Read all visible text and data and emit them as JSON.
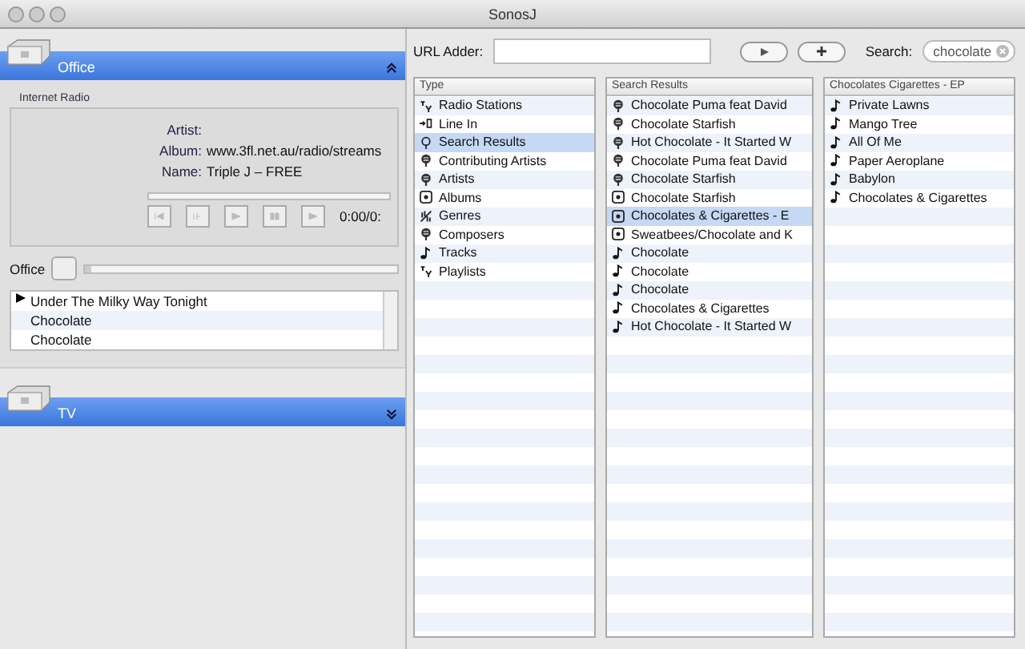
{
  "window": {
    "title": "SonosJ"
  },
  "zones": [
    {
      "name": "Office",
      "expanded": true
    },
    {
      "name": "TV",
      "expanded": false
    }
  ],
  "now_playing": {
    "source": "Internet Radio",
    "fields": [
      {
        "label": "Artist:"
      },
      {
        "label": "Album:",
        "value": "www.3fl.net.au/radio/streams"
      },
      {
        "label": "Name:",
        "value": "Triple J – FREE"
      }
    ],
    "time": "0:00/0:",
    "progress": {
      "level": 0
    }
  },
  "volume": {
    "zone": "Office",
    "level": 0.02
  },
  "queue": [
    {
      "title": "Under The Milky Way Tonight",
      "playing": true
    },
    {
      "title": "Chocolate",
      "playing": false
    },
    {
      "title": "Chocolate",
      "playing": false
    }
  ],
  "toolbar": {
    "url_label": "URL Adder:",
    "search_label": "Search:",
    "search_value": "chocolate"
  },
  "columns": [
    {
      "header": "Type",
      "items": [
        {
          "label": "Radio Stations",
          "kind": "radio",
          "selected": false
        },
        {
          "label": "Line In",
          "kind": "line-in",
          "selected": false
        },
        {
          "label": "Search Results",
          "kind": "search",
          "selected": true
        },
        {
          "label": "Contributing Artists",
          "kind": "artist",
          "selected": false
        },
        {
          "label": "Artists",
          "kind": "artist",
          "selected": false
        },
        {
          "label": "Albums",
          "kind": "album",
          "selected": false
        },
        {
          "label": "Genres",
          "kind": "genre",
          "selected": false
        },
        {
          "label": "Composers",
          "kind": "artist",
          "selected": false
        },
        {
          "label": "Tracks",
          "kind": "track",
          "selected": false
        },
        {
          "label": "Playlists",
          "kind": "radio",
          "selected": false
        }
      ]
    },
    {
      "header": "Search Results",
      "items": [
        {
          "label": "Chocolate Puma feat David",
          "kind": "artist",
          "selected": false
        },
        {
          "label": "Chocolate Starfish",
          "kind": "artist",
          "selected": false
        },
        {
          "label": "Hot Chocolate - It Started W",
          "kind": "artist",
          "selected": false
        },
        {
          "label": "Chocolate Puma feat David",
          "kind": "artist",
          "selected": false
        },
        {
          "label": "Chocolate Starfish",
          "kind": "artist",
          "selected": false
        },
        {
          "label": "Chocolate Starfish",
          "kind": "album",
          "selected": false
        },
        {
          "label": "Chocolates & Cigarettes - E",
          "kind": "album",
          "selected": true
        },
        {
          "label": "Sweatbees/Chocolate and K",
          "kind": "album",
          "selected": false
        },
        {
          "label": "Chocolate",
          "kind": "track",
          "selected": false
        },
        {
          "label": "Chocolate",
          "kind": "track",
          "selected": false
        },
        {
          "label": "Chocolate",
          "kind": "track",
          "selected": false
        },
        {
          "label": "Chocolates & Cigarettes",
          "kind": "track",
          "selected": false
        },
        {
          "label": "Hot Chocolate - It Started W",
          "kind": "track",
          "selected": false
        }
      ]
    },
    {
      "header": "Chocolates  Cigarettes - EP",
      "items": [
        {
          "label": "Private Lawns",
          "kind": "track",
          "selected": false
        },
        {
          "label": "Mango Tree",
          "kind": "track",
          "selected": false
        },
        {
          "label": "All Of Me",
          "kind": "track",
          "selected": false
        },
        {
          "label": "Paper Aeroplane",
          "kind": "track",
          "selected": false
        },
        {
          "label": "Babylon",
          "kind": "track",
          "selected": false
        },
        {
          "label": "Chocolates & Cigarettes",
          "kind": "track",
          "selected": false
        }
      ]
    }
  ]
}
